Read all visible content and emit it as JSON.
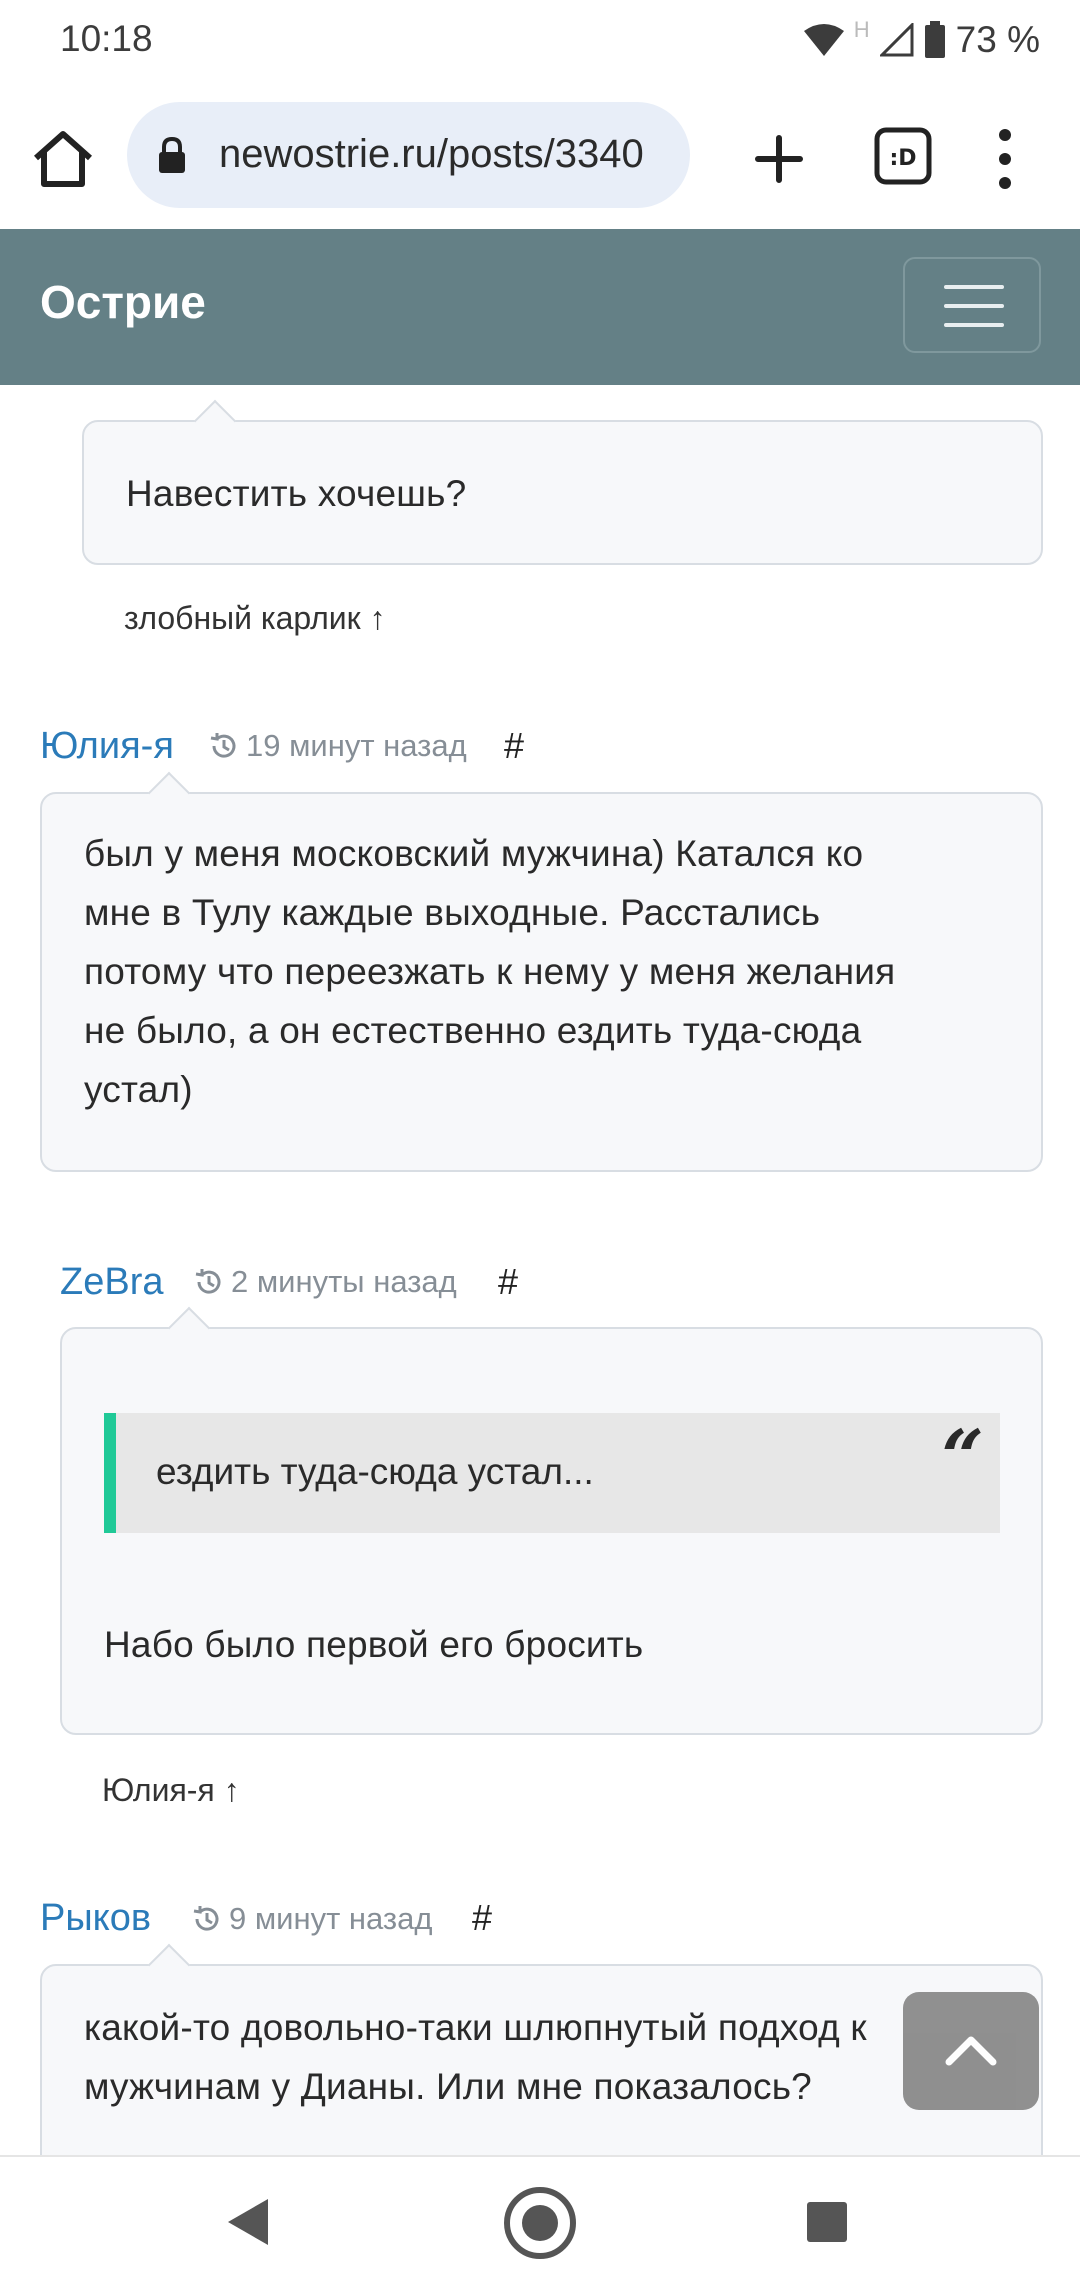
{
  "status_bar": {
    "time": "10:18",
    "signal_letter": "H",
    "battery_percent": "73 %"
  },
  "browser": {
    "url": "newostrie.ru/posts/3340"
  },
  "site": {
    "brand": "Острие"
  },
  "comments": {
    "prev": {
      "text": "Навестить хочешь?",
      "reply_to": "злобный карлик ↑"
    },
    "c1": {
      "author": "Юлия-я",
      "time": "19 минут назад",
      "hash": "#",
      "lines": [
        "был у меня московский мужчина) Катался ко",
        "мне в Тулу каждые выходные. Расстались",
        "потому что переезжать к нему у меня желания",
        "не было, а он естественно ездить туда-сюда",
        "устал)"
      ]
    },
    "c2": {
      "author": "ZeBra",
      "time": "2 минуты назад",
      "hash": "#",
      "quote": "ездить туда-сюда устал...",
      "quote_mark": "“",
      "text": "Набо было первой его бросить",
      "reply_to": "Юлия-я ↑"
    },
    "c3": {
      "author": "Рыков",
      "time": "9 минут назад",
      "hash": "#",
      "lines": [
        "какой-то довольно-таки шлюпнутый подход к",
        "мужчинам у Дианы. Или мне показалось?"
      ]
    }
  }
}
